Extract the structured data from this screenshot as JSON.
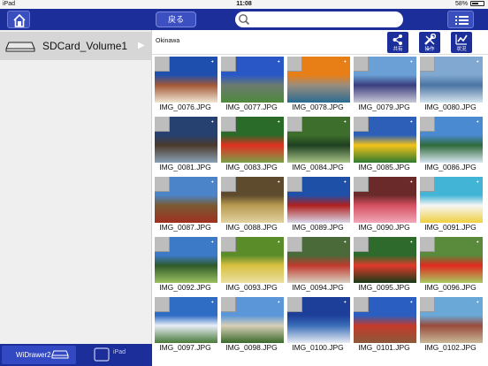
{
  "status": {
    "device": "iPad",
    "time": "11:08",
    "battery": "58%",
    "battery_level": 0.58
  },
  "topbar": {
    "back_label": "戻る",
    "search_placeholder": ""
  },
  "sidebar": {
    "volume_label": "SDCard_Volume1",
    "tabs": {
      "wi_drawer": "WiDrawer2",
      "ipad": "iPad"
    }
  },
  "path": {
    "folder": "Okinawa"
  },
  "actions": [
    {
      "label": "共有",
      "icon": "share-icon"
    },
    {
      "label": "操作",
      "icon": "tools-icon"
    },
    {
      "label": "状況",
      "icon": "chart-icon"
    }
  ],
  "files": [
    {
      "name": "IMG_0076.JPG",
      "colors": [
        "#1f4fae",
        "#a35836",
        "#f0e6d3"
      ]
    },
    {
      "name": "IMG_0077.JPG",
      "colors": [
        "#2958c6",
        "#6b7a70",
        "#4f8a3c"
      ]
    },
    {
      "name": "IMG_0078.JPG",
      "colors": [
        "#e87e16",
        "#9a8d7c",
        "#2a6b92"
      ]
    },
    {
      "name": "IMG_0079.JPG",
      "colors": [
        "#6aa0d5",
        "#3a3e7e",
        "#c9c9d6"
      ]
    },
    {
      "name": "IMG_0080.JPG",
      "colors": [
        "#80a8d0",
        "#4a74a2",
        "#d6e4f0"
      ]
    },
    {
      "name": "IMG_0081.JPG",
      "colors": [
        "#264070",
        "#4b3a2c",
        "#8aa0b5"
      ]
    },
    {
      "name": "IMG_0083.JPG",
      "colors": [
        "#2b6b2a",
        "#e03020",
        "#7aa04b"
      ]
    },
    {
      "name": "IMG_0084.JPG",
      "colors": [
        "#3d6e2c",
        "#1e4020",
        "#a8c286"
      ]
    },
    {
      "name": "IMG_0085.JPG",
      "colors": [
        "#2d5fb8",
        "#f2c31a",
        "#2f7a2f"
      ]
    },
    {
      "name": "IMG_0086.JPG",
      "colors": [
        "#4a8ad0",
        "#2f6a3a",
        "#d8e6f0"
      ]
    },
    {
      "name": "IMG_0087.JPG",
      "colors": [
        "#4b84c8",
        "#7a5a32",
        "#a03020"
      ]
    },
    {
      "name": "IMG_0088.JPG",
      "colors": [
        "#5e4a2c",
        "#b89a52",
        "#e2d2a0"
      ]
    },
    {
      "name": "IMG_0089.JPG",
      "colors": [
        "#1f50a8",
        "#b0201e",
        "#d8d8e8"
      ]
    },
    {
      "name": "IMG_0090.JPG",
      "colors": [
        "#6a2a2a",
        "#d65060",
        "#f0a8b8"
      ]
    },
    {
      "name": "IMG_0091.JPG",
      "colors": [
        "#42b4d6",
        "#f6f6f6",
        "#f0d040"
      ]
    },
    {
      "name": "IMG_0092.JPG",
      "colors": [
        "#3c7ac8",
        "#2f5a2a",
        "#9ac060"
      ]
    },
    {
      "name": "IMG_0093.JPG",
      "colors": [
        "#5b8c2a",
        "#d8c040",
        "#eae0a0"
      ]
    },
    {
      "name": "IMG_0094.JPG",
      "colors": [
        "#4a6a3a",
        "#c03a2e",
        "#d8d0c0"
      ]
    },
    {
      "name": "IMG_0095.JPG",
      "colors": [
        "#2d6a2c",
        "#e03a2a",
        "#183a18"
      ]
    },
    {
      "name": "IMG_0096.JPG",
      "colors": [
        "#5a8a3c",
        "#e02a20",
        "#a8c860"
      ]
    },
    {
      "name": "IMG_0097.JPG",
      "colors": [
        "#2f6cc4",
        "#e8eef8",
        "#4a7a3a"
      ]
    },
    {
      "name": "IMG_0098.JPG",
      "colors": [
        "#5a96d8",
        "#d8d0b8",
        "#3a6a2a"
      ]
    },
    {
      "name": "IMG_0100.JPG",
      "colors": [
        "#1d3f9a",
        "#3a6eb8",
        "#e8ecf4"
      ]
    },
    {
      "name": "IMG_0101.JPG",
      "colors": [
        "#2a5ec0",
        "#c43a2a",
        "#8a5a3a"
      ]
    },
    {
      "name": "IMG_0102.JPG",
      "colors": [
        "#6aa8d8",
        "#9a4a3a",
        "#c8b898"
      ]
    }
  ]
}
